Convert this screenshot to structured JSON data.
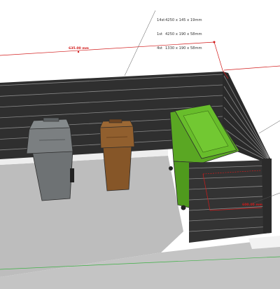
{
  "colors": {
    "background": "#ffffff",
    "ground": "#b9b9b9",
    "plank": "#3d3d3d",
    "plank_top": "#4b4b4b",
    "bin_grey": "#74787a",
    "bin_brown": "#8a5a2e",
    "bin_green": "#62b528",
    "dimension_line": "#d21b1b"
  },
  "bom": {
    "rows": [
      {
        "qty": "14st",
        "size": "4250 x 145 x 19mm"
      },
      {
        "qty": "1st",
        "size": "4250 x 190 x 58mm"
      },
      {
        "qty": "4st",
        "size": "1330 x 190 x 58mm"
      }
    ]
  },
  "dimensions": {
    "overall_width": "635.00 mm",
    "enclosure_width": "600.00 mm"
  },
  "objects": {
    "bins": [
      "grey-wheelie-bin",
      "brown-wheelie-bin",
      "green-container-bin"
    ]
  }
}
